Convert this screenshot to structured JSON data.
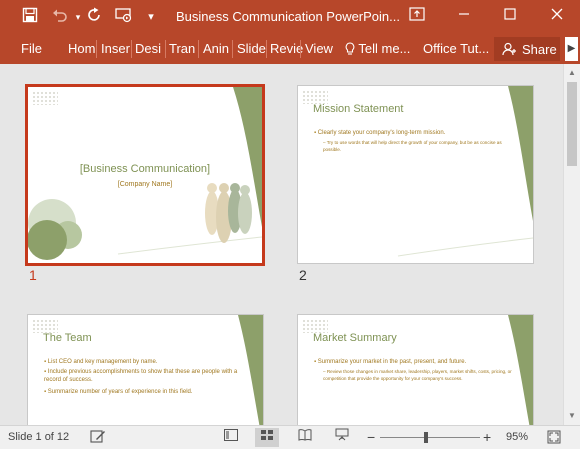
{
  "title_bar": {
    "document_title": "Business Communication PowerPoin...",
    "icons": [
      "save-icon",
      "undo-icon",
      "redo-icon",
      "present-icon",
      "customize-icon",
      "ribbon-display-icon",
      "minimize-icon",
      "restore-icon",
      "close-icon"
    ]
  },
  "ribbon": {
    "tabs": [
      "File",
      "Hom",
      "Inser",
      "Desi",
      "Tran",
      "Anin",
      "Slide",
      "Revie",
      "View"
    ],
    "tell_me": "Tell me...",
    "office_tut": "Office Tut...",
    "share": "Share"
  },
  "slides": [
    {
      "number": "1",
      "title": "[Business Communication]",
      "subtitle": "[Company Name]",
      "selected": true
    },
    {
      "number": "2",
      "title": "Mission Statement",
      "bullets": [
        "Clearly state your company's long-term mission."
      ],
      "sub": [
        "Try to use words that will help direct the growth of your company, but be as concise as possible."
      ]
    },
    {
      "number": "3",
      "title": "The Team",
      "bullets": [
        "List CEO and key management by name.",
        "Include previous accomplishments to show that these are people with a record of success.",
        "Summarize number of years of experience in this field."
      ]
    },
    {
      "number": "4",
      "title": "Market Summary",
      "bullets": [
        "Summarize your market in the past, present, and future."
      ],
      "sub": [
        "Review those changes in market share, leadership, players, market shifts, costs, pricing, or competition that provide the opportunity for your company's success."
      ]
    }
  ],
  "status_bar": {
    "slide_info": "Slide 1 of 12",
    "zoom": "95%",
    "zoom_level": 0.95
  },
  "colors": {
    "brand": "#b7472a",
    "slide_accent": "#8da06a",
    "selection": "#c5391c"
  }
}
